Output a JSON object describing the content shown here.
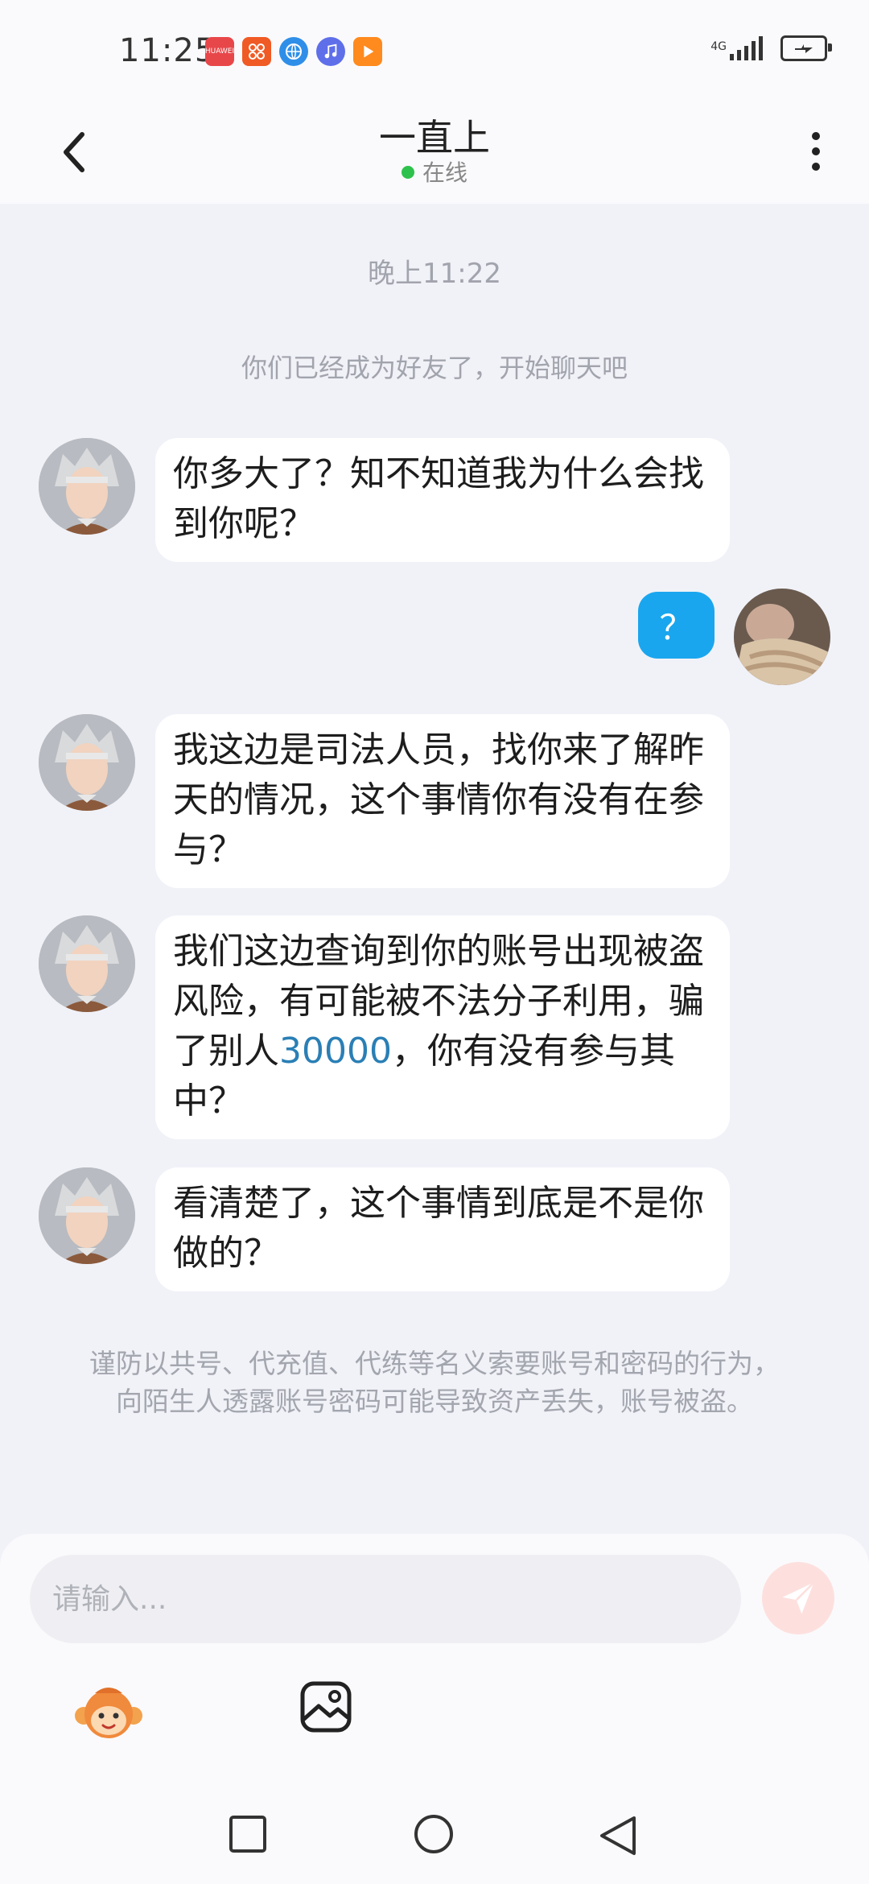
{
  "status_bar": {
    "time": "11:25",
    "network": "4G",
    "apps": [
      {
        "icon": "huawei-appgallery-icon",
        "label": "HUAWEI",
        "color": "#e8474a"
      },
      {
        "icon": "app-orange-icon",
        "color": "#f05a24"
      },
      {
        "icon": "browser-icon",
        "color": "#2f8fe8"
      },
      {
        "icon": "music-icon",
        "color": "#5f6fea"
      },
      {
        "icon": "video-icon",
        "color": "#ff8a1e"
      }
    ]
  },
  "header": {
    "title": "一直上",
    "status": "在线"
  },
  "chat": {
    "time": "晚上11:22",
    "system_message": "你们已经成为好友了，开始聊天吧",
    "messages": [
      {
        "from": "other",
        "text": "你多大了？知不知道我为什么会找到你呢？"
      },
      {
        "from": "self",
        "text": "？"
      },
      {
        "from": "other",
        "text": "我这边是司法人员，找你来了解昨天的情况，这个事情你有没有在参与？"
      },
      {
        "from": "other",
        "text_before": "我们这边查询到你的账号出现被盗风险，有可能被不法分子利用，骗了别人",
        "highlight": "30000",
        "text_after": "，你有没有参与其中？"
      },
      {
        "from": "other",
        "text": "看清楚了，这个事情到底是不是你做的？"
      }
    ],
    "warning": "谨防以共号、代充值、代练等名义索要账号和密码的行为，向陌生人透露账号密码可能导致资产丢失，账号被盗。"
  },
  "input": {
    "placeholder": "请输入..."
  },
  "colors": {
    "accent_blue": "#1aa6ee",
    "online_green": "#2ec24c",
    "highlight_link": "#2a7fb5",
    "send_button": "#fde0de"
  }
}
